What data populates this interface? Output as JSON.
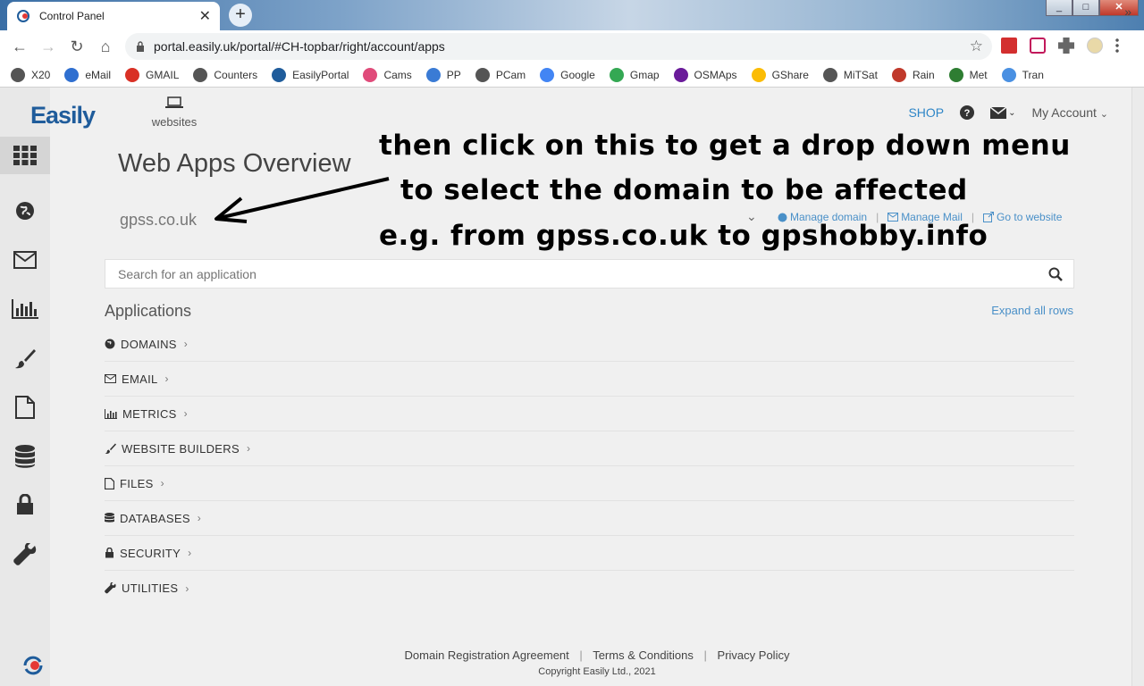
{
  "browser": {
    "tab_title": "Control Panel",
    "url": "portal.easily.uk/portal/#CH-topbar/right/account/apps",
    "window_controls": [
      "_",
      "□",
      "✕"
    ],
    "bookmarks": [
      {
        "label": "X20",
        "color": "#555555"
      },
      {
        "label": "eMail",
        "color": "#2f6fd0"
      },
      {
        "label": "GMAIL",
        "color": "#d93025"
      },
      {
        "label": "Counters",
        "color": "#555555"
      },
      {
        "label": "EasilyPortal",
        "color": "#1f5c9b"
      },
      {
        "label": "Cams",
        "color": "#e04b7a"
      },
      {
        "label": "PP",
        "color": "#3a7bd5"
      },
      {
        "label": "PCam",
        "color": "#555555"
      },
      {
        "label": "Google",
        "color": "#4285f4"
      },
      {
        "label": "Gmap",
        "color": "#34a853"
      },
      {
        "label": "OSMAps",
        "color": "#6a1b9a"
      },
      {
        "label": "GShare",
        "color": "#fbbc05"
      },
      {
        "label": "MiTSat",
        "color": "#555555"
      },
      {
        "label": "Rain",
        "color": "#c0392b"
      },
      {
        "label": "Met",
        "color": "#2e7d32"
      },
      {
        "label": "Tran",
        "color": "#4a90e2"
      }
    ],
    "bookmarks_more": "»"
  },
  "portal": {
    "logo_text": "Easily",
    "websites_label": "websites",
    "shop_label": "SHOP",
    "account_label": "My Account",
    "page_title": "Web Apps Overview",
    "selected_domain": "gpss.co.uk",
    "domain_links": [
      "Manage domain",
      "Manage Mail",
      "Go to website"
    ],
    "link_separator": "|",
    "search_placeholder": "Search for an application",
    "applications_header": "Applications",
    "expand_all": "Expand all rows",
    "applications": [
      {
        "label": "DOMAINS",
        "icon": "globe-icon"
      },
      {
        "label": "EMAIL",
        "icon": "envelope-icon"
      },
      {
        "label": "METRICS",
        "icon": "bar-chart-icon"
      },
      {
        "label": "WEBSITE BUILDERS",
        "icon": "brush-icon"
      },
      {
        "label": "FILES",
        "icon": "file-icon"
      },
      {
        "label": "DATABASES",
        "icon": "database-icon"
      },
      {
        "label": "SECURITY",
        "icon": "lock-icon"
      },
      {
        "label": "UTILITIES",
        "icon": "wrench-icon"
      }
    ],
    "footer_links": [
      "Domain Registration Agreement",
      "Terms & Conditions",
      "Privacy Policy"
    ],
    "copyright": "Copyright Easily Ltd., 2021"
  },
  "annotation": {
    "line1": "then click on this to get a drop down menu",
    "line2": "to select the domain to be affected",
    "line3": "e.g. from gpss.co.uk to gpshobby.info"
  },
  "colors": {
    "accent": "#2f86c7",
    "link": "#4a90c8",
    "logo": "#1f5c9b"
  }
}
